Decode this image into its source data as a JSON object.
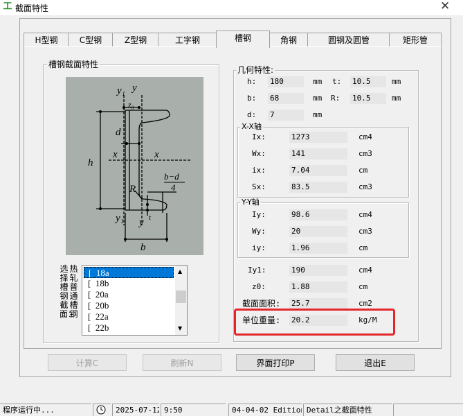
{
  "window": {
    "icon_glyph": "工",
    "title": "截面特性",
    "close_glyph": "✕"
  },
  "tabs": [
    "H型钢",
    "C型钢",
    "Z型钢",
    "工字钢",
    "槽钢",
    "角钢",
    "圆钢及圆管",
    "矩形管"
  ],
  "active_tab": "槽钢",
  "section_group_title": "槽钢截面特性",
  "selector_label": {
    "col1": "选择槽钢截面：",
    "col2": "热轧普通槽钢"
  },
  "steel_list": [
    {
      "mark": "[",
      "name": "18a"
    },
    {
      "mark": "[",
      "name": "18b"
    },
    {
      "mark": "[",
      "name": "20a"
    },
    {
      "mark": "[",
      "name": "20b"
    },
    {
      "mark": "[",
      "name": "22a"
    },
    {
      "mark": "[",
      "name": "22b"
    }
  ],
  "selected_item": "18a",
  "diagram_labels": {
    "y1_top": "y₁",
    "y_top": "y",
    "z0": "z₀",
    "d": "d",
    "h": "h",
    "x_left": "x",
    "x_right": "x",
    "R": "R",
    "bd4_num": "b−d",
    "bd4_den": "4",
    "y1_bottom": "y₁",
    "y_bottom": "y",
    "t": "t",
    "b": "b"
  },
  "geom": {
    "title": "几何特性:",
    "h": {
      "label": "h:",
      "value": "180",
      "unit": "mm"
    },
    "t": {
      "label": "t:",
      "value": "10.5",
      "unit": "mm"
    },
    "b": {
      "label": "b:",
      "value": "68",
      "unit": "mm"
    },
    "R": {
      "label": "R:",
      "value": "10.5",
      "unit": "mm"
    },
    "d": {
      "label": "d:",
      "value": "7",
      "unit": "mm"
    }
  },
  "xx": {
    "title": "X-X轴",
    "Ix": {
      "label": "Ix:",
      "value": "1273",
      "unit": "cm4"
    },
    "Wx": {
      "label": "Wx:",
      "value": "141",
      "unit": "cm3"
    },
    "ix": {
      "label": "ix:",
      "value": "7.04",
      "unit": "cm"
    },
    "Sx": {
      "label": "Sx:",
      "value": "83.5",
      "unit": "cm3"
    }
  },
  "yy": {
    "title": "Y-Y轴",
    "Iy": {
      "label": "Iy:",
      "value": "98.6",
      "unit": "cm4"
    },
    "Wy": {
      "label": "Wy:",
      "value": "20",
      "unit": "cm3"
    },
    "iy": {
      "label": "iy:",
      "value": "1.96",
      "unit": "cm"
    }
  },
  "extra": {
    "Iy1": {
      "label": "Iy1:",
      "value": "190",
      "unit": "cm4"
    },
    "z0": {
      "label": "z0:",
      "value": "1.88",
      "unit": "cm"
    },
    "area": {
      "label": "截面面积:",
      "value": "25.7",
      "unit": "cm2"
    },
    "weight": {
      "label": "单位重量:",
      "value": "20.2",
      "unit": "kg/M"
    }
  },
  "buttons": {
    "calc": "计算C",
    "refresh": "刷新N",
    "print": "界面打印P",
    "exit": "退出E"
  },
  "status": {
    "state": "程序运行中...",
    "date": "2025-07-12",
    "time": "9:50",
    "edition": "04-04-02 Edition",
    "module": "Detail之截面特性"
  },
  "highlight_color": "#e3262a"
}
